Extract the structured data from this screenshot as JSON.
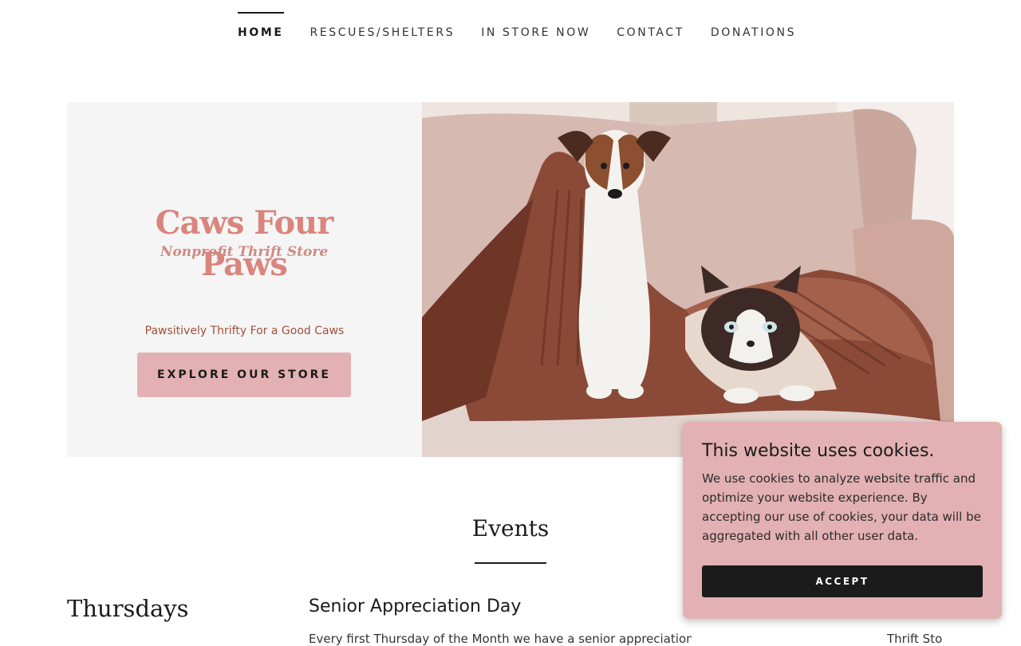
{
  "nav": {
    "items": [
      {
        "label": "HOME",
        "active": true
      },
      {
        "label": "RESCUES/SHELTERS",
        "active": false
      },
      {
        "label": "IN STORE NOW",
        "active": false
      },
      {
        "label": "CONTACT",
        "active": false
      },
      {
        "label": "DONATIONS",
        "active": false
      }
    ]
  },
  "hero": {
    "logo_title": "Caws Four Paws",
    "logo_subtitle": "Nonprofit Thrift Store",
    "tagline": "Pawsitively Thrifty For a Good Caws",
    "cta_label": "EXPLORE OUR STORE"
  },
  "events": {
    "title": "Events",
    "day": "Thursdays",
    "event_title": "Senior Appreciation Day",
    "event_desc": "Every first Thursday of the Month we have a senior appreciation day f",
    "event_desc_right": "Thrift Sto"
  },
  "cookie": {
    "title": "This website uses cookies.",
    "body": "We use cookies to analyze website traffic and optimize your website experience. By accepting our use of cookies, your data will be aggregated with all other user data.",
    "accept_label": "ACCEPT"
  },
  "colors": {
    "accent_pink": "#e3b1b3",
    "tagline_brown": "#a1513a",
    "dark": "#1b1b1b"
  }
}
